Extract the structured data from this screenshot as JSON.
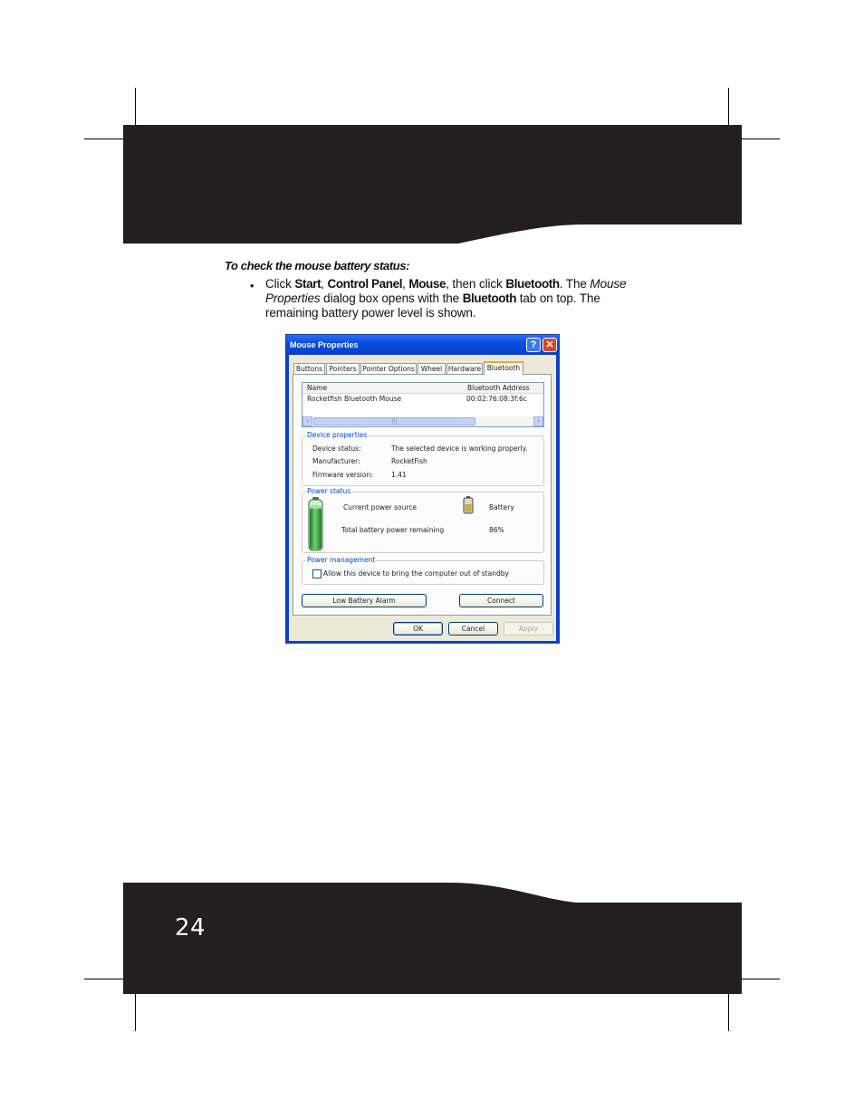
{
  "page": {
    "number": "24"
  },
  "instructions": {
    "heading": "To check the mouse battery status:",
    "bullet": "•",
    "step": {
      "t1": "Click ",
      "b1": "Start",
      "t2": ", ",
      "b2": "Control Panel",
      "t3": ", ",
      "b3": "Mouse",
      "t4": ", then click ",
      "b4": "Bluetooth",
      "t5": ". The ",
      "i1": "Mouse Properties",
      "t6": " dialog box opens with the ",
      "b5": "Bluetooth",
      "t7": " tab on top. The remaining battery power level is shown."
    }
  },
  "dialog": {
    "title": "Mouse Properties",
    "help_glyph": "?",
    "close_glyph": "✕",
    "tabs": [
      "Buttons",
      "Pointers",
      "Pointer Options",
      "Wheel",
      "Hardware",
      "Bluetooth"
    ],
    "active_tab": "Bluetooth",
    "device_list": {
      "columns": [
        "Name",
        "Bluetooth Address"
      ],
      "rows": [
        {
          "name": "Rocketfish Bluetooth Mouse",
          "address": "00:02:76:08:3f:6c"
        }
      ],
      "scroll_left": "‹",
      "scroll_right": "›",
      "scroll_grip": "|||"
    },
    "device_properties": {
      "title": "Device properties",
      "status_label": "Device status:",
      "status_value": "The selected device is working properly.",
      "manufacturer_label": "Manufacturer:",
      "manufacturer_value": "RocketFish",
      "firmware_label": "Firmware version:",
      "firmware_value": "1.41"
    },
    "power_status": {
      "title": "Power status",
      "source_label": "Current power source",
      "source_value": "Battery",
      "remaining_label": "Total battery power remaining",
      "remaining_value": "86%",
      "level_fraction": 0.86
    },
    "power_management": {
      "title": "Power management",
      "standby_label": "Allow this device to bring the computer out of standby",
      "standby_checked": false
    },
    "buttons": {
      "low_battery_alarm": "Low Battery Alarm",
      "connect": "Connect",
      "ok": "OK",
      "cancel": "Cancel",
      "apply": "Apply"
    }
  },
  "colors": {
    "band": "#231f20",
    "title_bar": "#0a4ee0",
    "dialog_face": "#ece9d8",
    "group_title": "#0046d5",
    "battery_green": "#2a9d3a"
  }
}
